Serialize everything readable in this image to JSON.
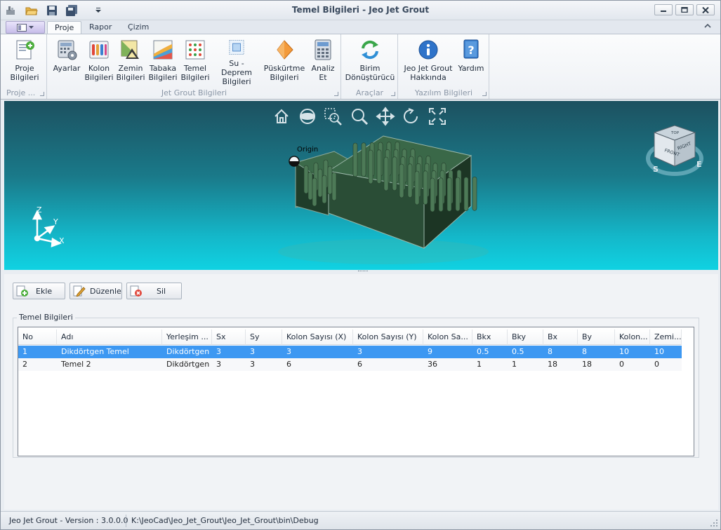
{
  "window": {
    "title": "Temel Bilgileri - Jeo Jet Grout"
  },
  "quick_access": {
    "icons": [
      "app-icon",
      "open-folder-icon",
      "save-icon",
      "save-all-icon",
      "customize-dropdown-icon"
    ]
  },
  "tabs": [
    {
      "label": "Proje",
      "active": true
    },
    {
      "label": "Rapor",
      "active": false
    },
    {
      "label": "Çizim",
      "active": false
    }
  ],
  "ribbon": {
    "groups": [
      {
        "label": "Proje ...",
        "buttons": [
          {
            "label": "Proje\nBilgileri",
            "icon": "project-info-icon"
          }
        ]
      },
      {
        "label": "Jet Grout Bilgileri",
        "buttons": [
          {
            "label": "Ayarlar",
            "icon": "settings-calculator-icon"
          },
          {
            "label": "Kolon\nBilgileri",
            "icon": "column-info-icon"
          },
          {
            "label": "Zemin\nBilgileri",
            "icon": "soil-info-icon"
          },
          {
            "label": "Tabaka\nBilgileri",
            "icon": "layer-info-icon"
          },
          {
            "label": "Temel\nBilgileri",
            "icon": "foundation-info-icon"
          },
          {
            "label": "Su - Deprem\nBilgileri",
            "icon": "water-earthquake-icon"
          },
          {
            "label": "Püskürtme\nBilgileri",
            "icon": "spray-info-icon"
          },
          {
            "label": "Analiz\nEt",
            "icon": "analyze-icon"
          }
        ]
      },
      {
        "label": "Araçlar",
        "buttons": [
          {
            "label": "Birim\nDönüştürücü",
            "icon": "unit-converter-icon"
          }
        ]
      },
      {
        "label": "Yazılım Bilgileri",
        "buttons": [
          {
            "label": "Jeo Jet Grout\nHakkında",
            "icon": "about-icon"
          },
          {
            "label": "Yardım",
            "icon": "help-icon"
          }
        ]
      }
    ]
  },
  "viewport": {
    "origin_label": "Origin",
    "axis_labels": {
      "x": "X",
      "y": "Y",
      "z": "Z"
    },
    "view_cube": {
      "front": "FRONT",
      "right": "RIGHT",
      "top": "TOP",
      "compass_s": "S",
      "compass_e": "E"
    },
    "toolbar_icons": [
      "home-icon",
      "orbit-icon",
      "zoom-window-icon",
      "zoom-icon",
      "pan-icon",
      "rotate-icon",
      "fit-extents-icon"
    ],
    "colors": {
      "bg_top": "#1c5160",
      "bg_bottom": "#10d2e2",
      "block": "#2f5a3c",
      "column": "#4d7a57"
    }
  },
  "toolbar": {
    "add_label": "Ekle",
    "edit_label": "Düzenle",
    "delete_label": "Sil"
  },
  "table": {
    "group_title": "Temel Bilgileri",
    "columns": [
      "No",
      "Adı",
      "Yerleşim ...",
      "Sx",
      "Sy",
      "Kolon Sayısı (X)",
      "Kolon Sayısı (Y)",
      "Kolon Sa...",
      "Bkx",
      "Bky",
      "Bx",
      "By",
      "Kolon...",
      "Zemi..."
    ],
    "rows": [
      {
        "selected": true,
        "cells": [
          "1",
          "Dikdörtgen Temel",
          "Dikdörtgen",
          "3",
          "3",
          "3",
          "3",
          "9",
          "0.5",
          "0.5",
          "8",
          "8",
          "10",
          "10"
        ]
      },
      {
        "selected": false,
        "cells": [
          "2",
          "Temel 2",
          "Dikdörtgen",
          "3",
          "3",
          "6",
          "6",
          "36",
          "1",
          "1",
          "18",
          "18",
          "0",
          "0"
        ]
      }
    ]
  },
  "statusbar": {
    "version": "Jeo Jet Grout - Version : 3.0.0.0",
    "path": "K:\\JeoCad\\Jeo_Jet_Grout\\Jeo_Jet_Grout\\bin\\Debug"
  }
}
